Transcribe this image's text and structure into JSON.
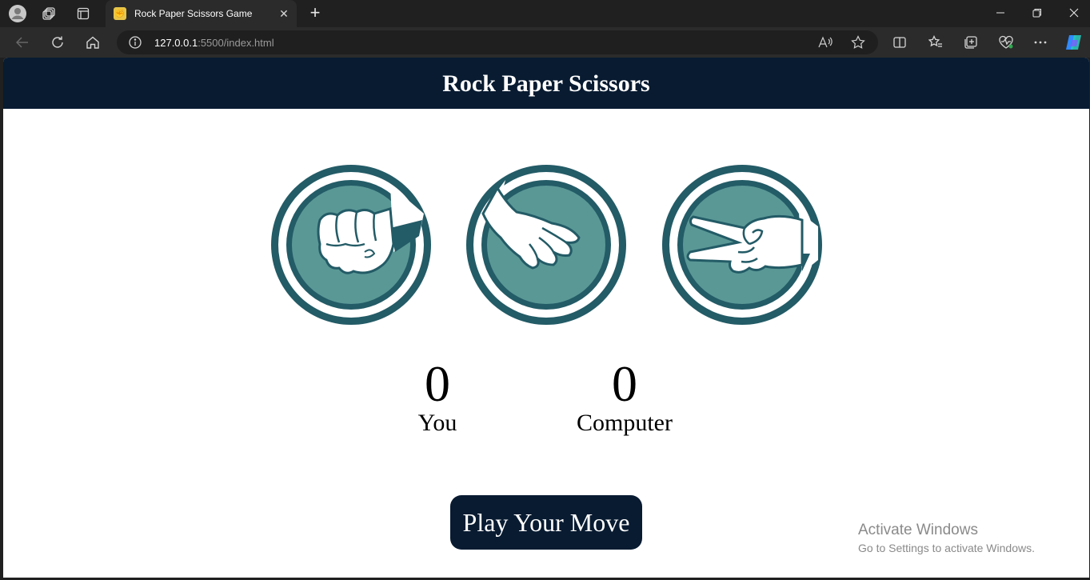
{
  "browser": {
    "tab": {
      "title": "Rock Paper Scissors Game",
      "favicon": "rps-favicon"
    },
    "url_host": "127.0.0.1",
    "url_rest": ":5500/index.html",
    "icons": [
      "profile-icon",
      "workspaces-icon",
      "tab-actions-icon",
      "close-tab-icon",
      "new-tab-icon",
      "minimize-icon",
      "restore-icon",
      "close-window-icon",
      "back-icon",
      "refresh-icon",
      "home-icon",
      "site-info-icon",
      "read-aloud-icon",
      "favorite-star-icon",
      "split-screen-icon",
      "favorites-icon",
      "collections-icon",
      "browser-essentials-icon",
      "more-icon",
      "copilot-icon"
    ]
  },
  "page": {
    "title": "Rock Paper Scissors",
    "choices": [
      {
        "name": "rock"
      },
      {
        "name": "paper"
      },
      {
        "name": "scissors"
      }
    ],
    "scores": {
      "user": {
        "value": "0",
        "label": "You"
      },
      "computer": {
        "value": "0",
        "label": "Computer"
      }
    },
    "play_button": "Play Your Move"
  },
  "watermark": {
    "line1": "Activate Windows",
    "line2": "Go to Settings to activate Windows."
  },
  "colors": {
    "header_bg": "#081b31",
    "circle_ring": "#235b66",
    "circle_fill": "#5a9896",
    "button_bg": "#081b31"
  }
}
